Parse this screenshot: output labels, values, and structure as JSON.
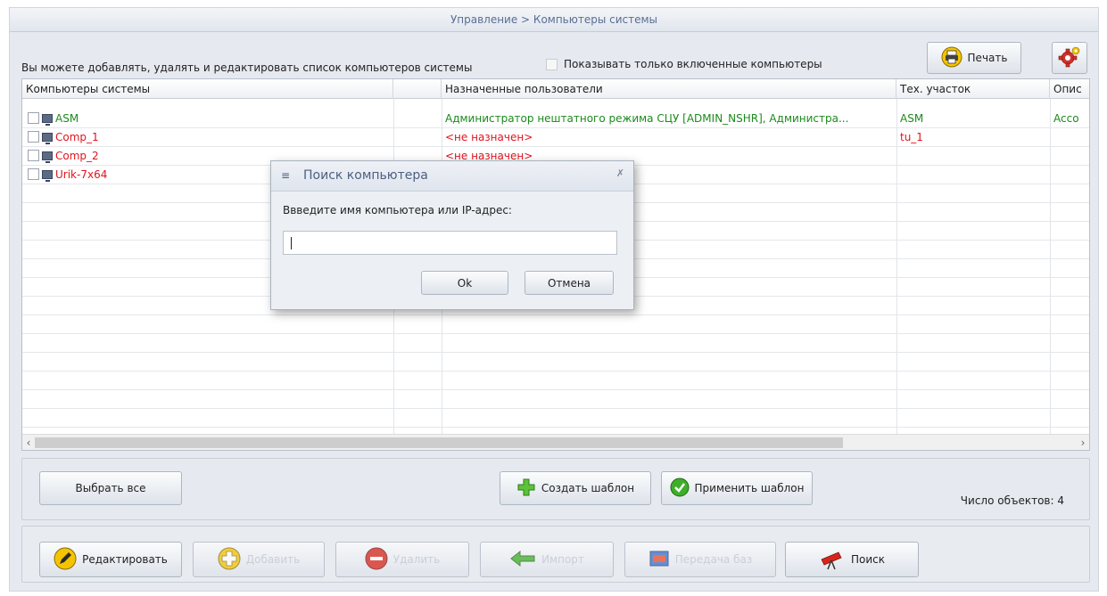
{
  "window": {
    "title": "Управление > Компьютеры системы"
  },
  "toolbar": {
    "info_text": "Вы можете добавлять, удалять и редактировать список компьютеров системы",
    "filter_label": "Показывать только включенные компьютеры",
    "filter_checked": false,
    "print_label": "Печать"
  },
  "grid": {
    "columns": [
      "Компьютеры системы",
      "",
      "Назначенные пользователи",
      "Тех. участок",
      "Опис"
    ],
    "rows": [
      {
        "name": "ASM",
        "users": "Администратор нештатного режима СЦУ [ADMIN_NSHR], Администра...",
        "area": "ASM",
        "desc": "Acco"
      },
      {
        "name": "Comp_1",
        "users": "<не назначен>",
        "area": "tu_1",
        "desc": ""
      },
      {
        "name": "Comp_2",
        "users": "<не назначен>",
        "area": "",
        "desc": ""
      },
      {
        "name": "Urik-7x64",
        "users": "",
        "area": "",
        "desc": ""
      }
    ],
    "colors": {
      "assigned": "#1c8a1c",
      "unassigned": "#e0141e"
    }
  },
  "actions": {
    "select_all": "Выбрать все",
    "create_template": "Создать шаблон",
    "apply_template": "Применить шаблон",
    "count_text": "Число объектов: 4"
  },
  "bottom": {
    "edit": "Редактировать",
    "add": "Добавить",
    "delete": "Удалить",
    "import": "Импорт",
    "transfer": "Передача баз",
    "search": "Поиск"
  },
  "dialog": {
    "title": "Поиск компьютера",
    "prompt": "Ввведите имя компьютера или IP-адрес:",
    "input_value": "",
    "ok": "Ok",
    "cancel": "Отмена"
  }
}
